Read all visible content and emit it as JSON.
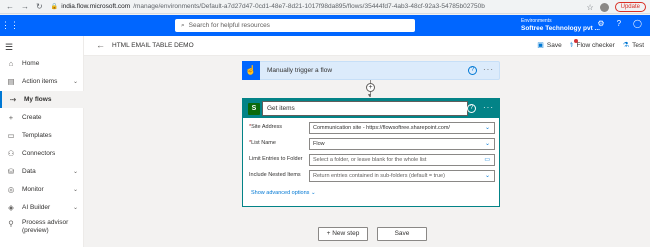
{
  "browser": {
    "url_host": "india.flow.microsoft.com",
    "url_path": "/manage/environments/Default-a7d27d47-0cd1-48e7-8d21-1017f98da895/flows/35444fd7-4ab3-48cf-92a3-54785b02750b",
    "update_label": "Update"
  },
  "topbar": {
    "search_placeholder": "Search for helpful resources",
    "env_label": "Environments",
    "env_value": "Softree Technology pvt ..."
  },
  "cmdbar": {
    "flow_title": "HTML EMAIL TABLE DEMO",
    "save_label": "Save",
    "checker_label": "Flow checker",
    "test_label": "Test"
  },
  "nav": {
    "items": [
      {
        "label": "Home"
      },
      {
        "label": "Action items"
      },
      {
        "label": "My flows"
      },
      {
        "label": "Create"
      },
      {
        "label": "Templates"
      },
      {
        "label": "Connectors"
      },
      {
        "label": "Data"
      },
      {
        "label": "Monitor"
      },
      {
        "label": "AI Builder"
      },
      {
        "label": "Process advisor (preview)"
      }
    ]
  },
  "trigger": {
    "label": "Manually trigger a flow"
  },
  "action": {
    "title": "Get items",
    "fields": [
      {
        "label": "Site Address",
        "required": "*",
        "value": "Communication site - https://flowsoftree.sharepoint.com/"
      },
      {
        "label": "List Name",
        "required": "*",
        "value": "Flow"
      },
      {
        "label": "Limit Entries to Folder",
        "required": "",
        "value": "Select a folder, or leave blank for the whole list"
      },
      {
        "label": "Include Nested Items",
        "required": "",
        "value": "Return entries contained in sub-folders (default = true)"
      }
    ],
    "advanced_label": "Show advanced options"
  },
  "footer": {
    "new_step_label": "+ New step",
    "save_label": "Save"
  }
}
